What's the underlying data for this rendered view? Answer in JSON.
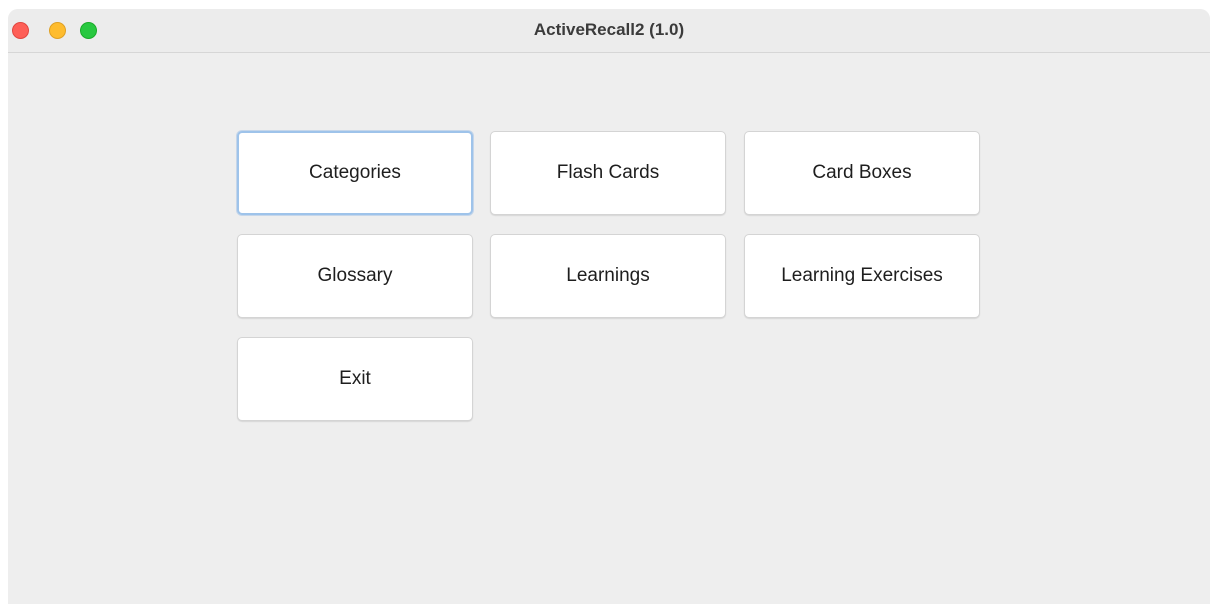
{
  "window": {
    "title": "ActiveRecall2 (1.0)"
  },
  "menu": {
    "categories": "Categories",
    "flash_cards": "Flash Cards",
    "card_boxes": "Card Boxes",
    "glossary": "Glossary",
    "learnings": "Learnings",
    "learning_exercises": "Learning Exercises",
    "exit": "Exit"
  },
  "colors": {
    "close": "#fe5f57",
    "minimize": "#febc2e",
    "zoom": "#28c840",
    "focus_ring": "#9ec3ea",
    "background": "#eeeeee"
  },
  "icons": [
    "close-icon",
    "minimize-icon",
    "zoom-icon"
  ]
}
